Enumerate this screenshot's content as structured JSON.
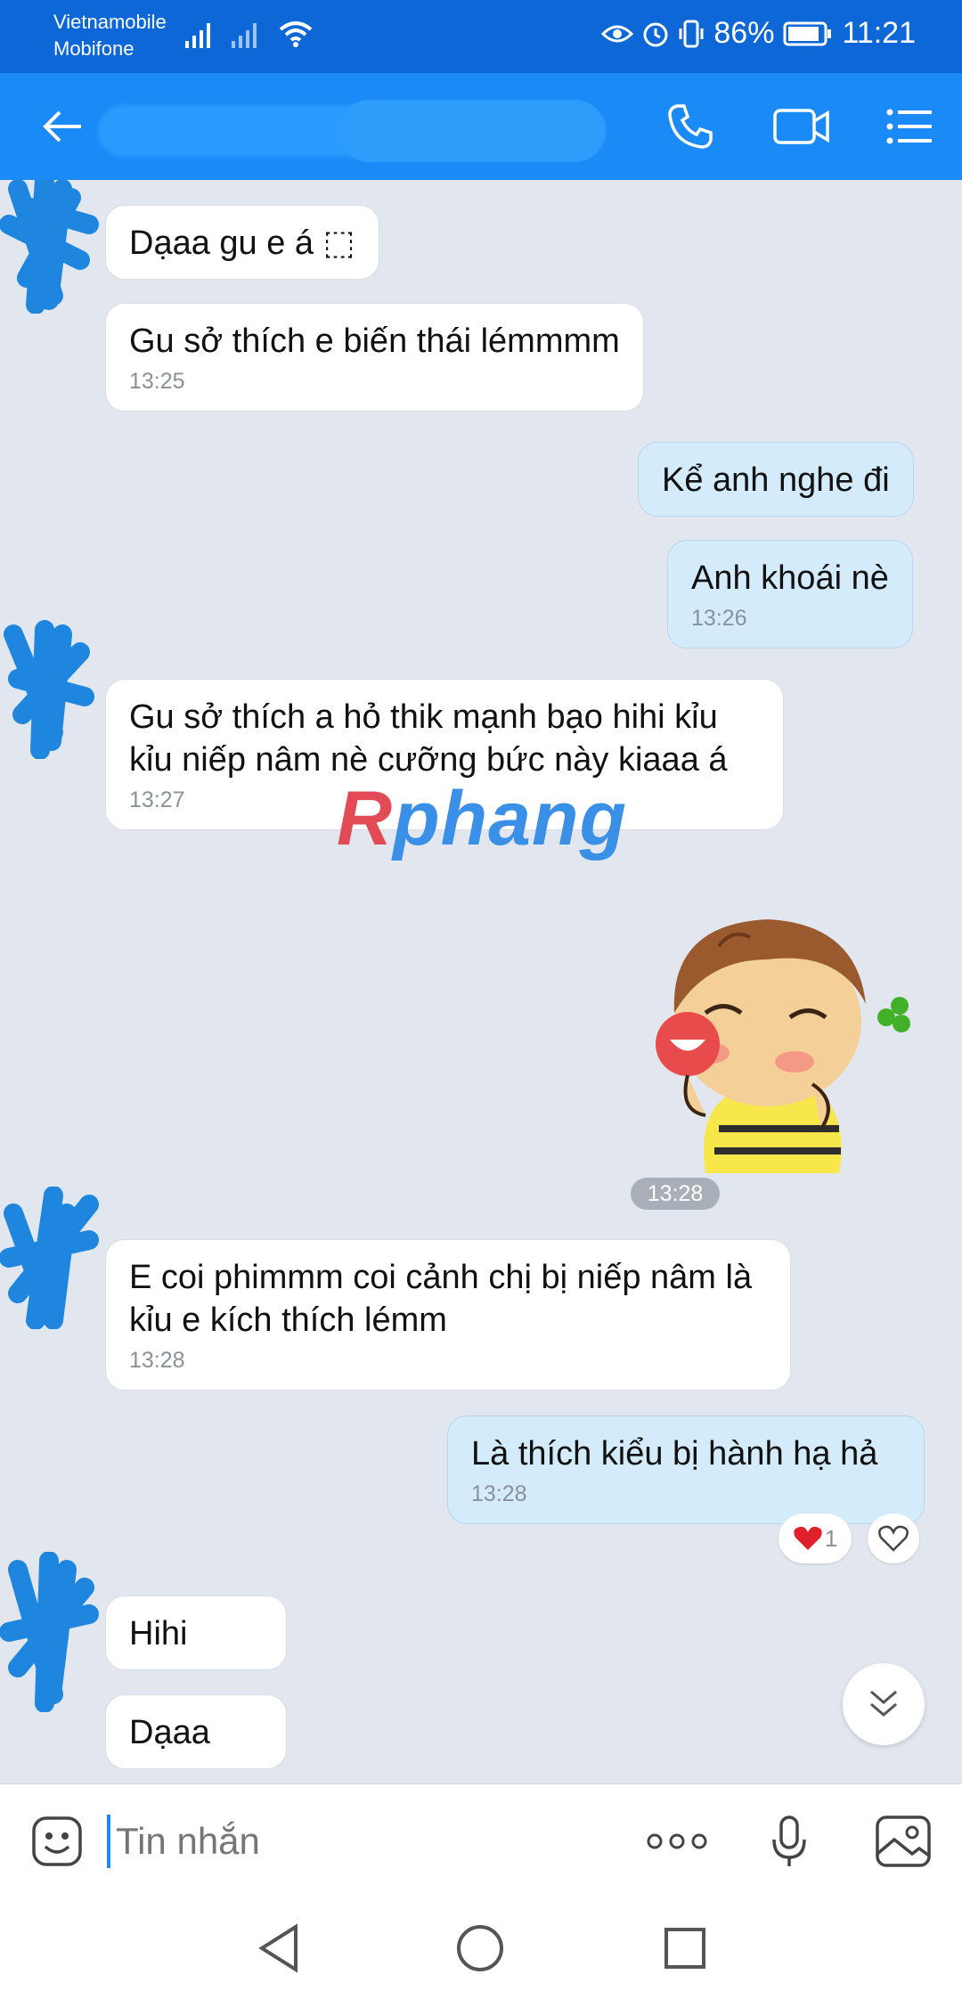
{
  "status_bar": {
    "carrier_1": "Vietnamobile",
    "carrier_2": "Mobifone",
    "battery": "86%",
    "clock": "11:21",
    "icons": [
      "signal-icon",
      "signal-icon",
      "wifi-icon",
      "eye-icon",
      "alarm-icon",
      "vibrate-icon",
      "battery-icon"
    ]
  },
  "header": {
    "back_icon": "back-arrow-icon",
    "call_icon": "phone-icon",
    "video_icon": "video-call-icon",
    "menu_icon": "menu-icon"
  },
  "messages": [
    {
      "side": "in",
      "text": "Dạaa gu e á ⬚",
      "time": ""
    },
    {
      "side": "in",
      "text": "Gu sở thích e biến thái lémmmm",
      "time": "13:25"
    },
    {
      "side": "out",
      "text": "Kể anh nghe đi",
      "time": ""
    },
    {
      "side": "out",
      "text": "Anh khoái nè",
      "time": "13:26"
    },
    {
      "side": "in",
      "text": "Gu sở thích a hỏ thik mạnh bạo hihi kỉu kỉu niếp nâm nè cưỡng bức này kiaaa á",
      "time": "13:27"
    },
    {
      "side": "in",
      "text": "E coi phimmm coi cảnh chị bị niếp nâm là kỉu e kích thích lémm",
      "time": "13:28"
    },
    {
      "side": "out",
      "text": "Là thích kiểu bị hành hạ hả",
      "time": "13:28"
    },
    {
      "side": "in",
      "text": "Hihi",
      "time": ""
    },
    {
      "side": "in",
      "text": "Dạaa",
      "time": ""
    }
  ],
  "sticker": {
    "time": "13:28"
  },
  "reaction": {
    "count": "1",
    "icon": "heart-icon"
  },
  "watermark": {
    "r": "R",
    "rest": "phang"
  },
  "input_bar": {
    "placeholder": "Tin nhắn",
    "emoji_icon": "emoji-icon",
    "more_icon": "more-icon",
    "mic_icon": "mic-icon",
    "image_icon": "image-icon"
  },
  "colors": {
    "header": "#1a8af7",
    "status": "#0d67d7",
    "in_bubble": "#ffffff",
    "out_bubble": "#d4ebfb",
    "background": "#e2e7ef"
  }
}
